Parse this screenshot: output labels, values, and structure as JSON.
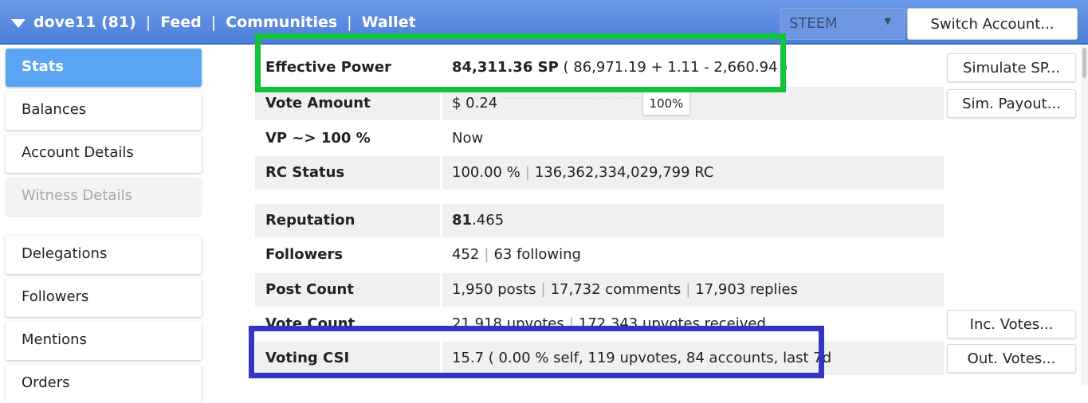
{
  "nav": {
    "account": "dove11 (81)",
    "sep": "|",
    "links": [
      "Feed",
      "Communities",
      "Wallet"
    ]
  },
  "chain_select": {
    "value": "STEEM",
    "caret": "▼"
  },
  "switch_account_label": "Switch Account...",
  "sidebar": {
    "items": [
      {
        "label": "Stats",
        "state": "active"
      },
      {
        "label": "Balances"
      },
      {
        "label": "Account Details"
      },
      {
        "label": "Witness Details",
        "state": "disabled"
      },
      {
        "label": "Delegations"
      },
      {
        "label": "Followers"
      },
      {
        "label": "Mentions"
      },
      {
        "label": "Orders"
      }
    ]
  },
  "stats": {
    "effective_power": {
      "label": "Effective Power",
      "value": "84,311.36 SP",
      "detail": "( 86,971.19 + 1.11 - 2,660.94 )"
    },
    "vote_amount": {
      "label": "Vote Amount",
      "value": "$ 0.24",
      "percent": "100%"
    },
    "vp": {
      "label": "VP ~> 100 %",
      "value": "Now"
    },
    "rc_status": {
      "label": "RC Status",
      "percent": "100.00 %",
      "rc": "136,362,334,029,799 RC"
    },
    "reputation": {
      "label": "Reputation",
      "int": "81",
      "dec": ".465"
    },
    "followers": {
      "label": "Followers",
      "count": "452",
      "following": "63 following"
    },
    "post_count": {
      "label": "Post Count",
      "posts": "1,950 posts",
      "comments": "17,732 comments",
      "replies": "17,903 replies"
    },
    "vote_count": {
      "label": "Vote Count",
      "upvotes": "21,918 upvotes",
      "received": "172,343 upvotes received"
    },
    "voting_csi": {
      "label": "Voting CSI",
      "value": "15.7 ( 0.00 % self, 119 upvotes, 84 accounts, last 7d"
    }
  },
  "buttons": {
    "simulate_sp": "Simulate SP...",
    "sim_payout": "Sim. Payout...",
    "inc_votes": "Inc. Votes...",
    "out_votes": "Out. Votes..."
  },
  "colors": {
    "topbar": "#5b8be0",
    "active_tab": "#5aa6f4",
    "highlight_green": "#11c43a",
    "highlight_blue": "#3535c4"
  }
}
